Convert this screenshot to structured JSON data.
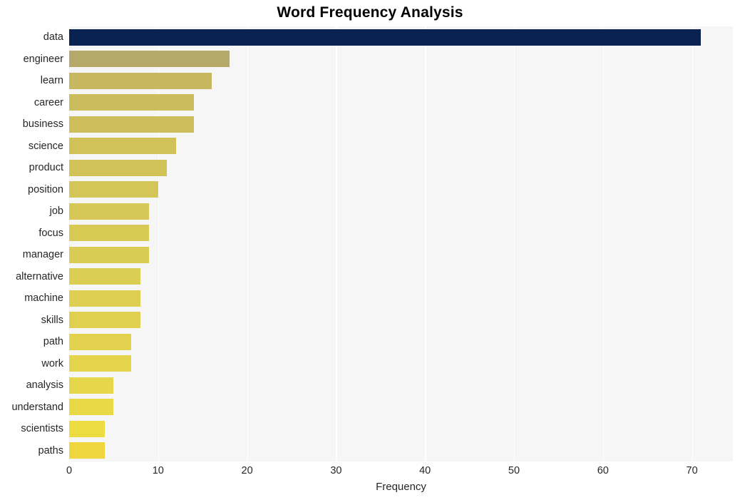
{
  "chart_data": {
    "type": "bar",
    "orientation": "horizontal",
    "title": "Word Frequency Analysis",
    "xlabel": "Frequency",
    "ylabel": "",
    "categories": [
      "data",
      "engineer",
      "learn",
      "career",
      "business",
      "science",
      "product",
      "position",
      "job",
      "focus",
      "manager",
      "alternative",
      "machine",
      "skills",
      "path",
      "work",
      "analysis",
      "understand",
      "scientists",
      "paths"
    ],
    "values": [
      71,
      18,
      16,
      14,
      14,
      12,
      11,
      10,
      9,
      9,
      9,
      8,
      8,
      8,
      7,
      7,
      5,
      5,
      4,
      4
    ],
    "xlim": [
      0,
      74.6
    ],
    "xticks": [
      0,
      10,
      20,
      30,
      40,
      50,
      60,
      70
    ],
    "xtick_labels": [
      "0",
      "10",
      "20",
      "30",
      "40",
      "50",
      "60",
      "70"
    ],
    "grid": "vertical-only",
    "legend": "none",
    "bar_colors": [
      "#0a2250",
      "#b5a868",
      "#c7b85f",
      "#cbbc5c",
      "#cdbe5b",
      "#d0c159",
      "#d2c358",
      "#d4c557",
      "#d6c756",
      "#d8c955",
      "#dacb54",
      "#dccd53",
      "#dece52",
      "#e0d050",
      "#e2d24e",
      "#e4d44c",
      "#e6d64a",
      "#e9d946",
      "#ecdc42",
      "#f0d63e"
    ],
    "plot_background": "#f6f6f6",
    "gridline_color": "#ffffff",
    "text_color": "#262626",
    "title_color": "#000000"
  }
}
